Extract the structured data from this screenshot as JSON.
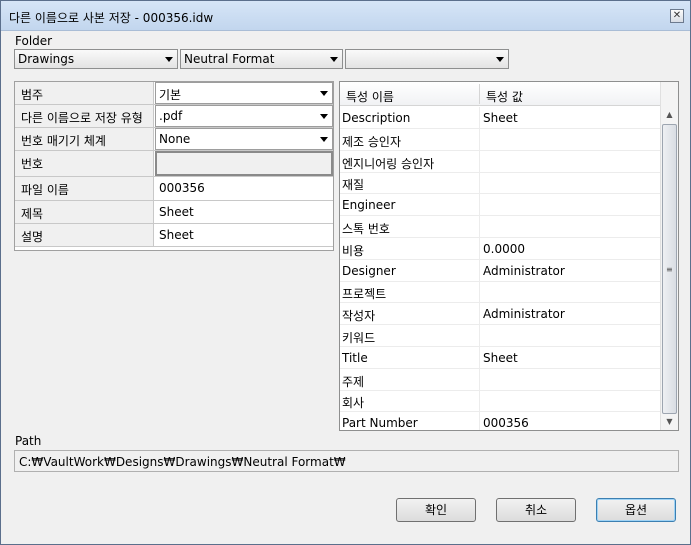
{
  "window": {
    "title": "다른 이름으로 사본 저장 - 000356.idw",
    "close_glyph": "✕"
  },
  "folder": {
    "label": "Folder",
    "combo1": "Drawings",
    "combo2": "Neutral Format",
    "combo3": ""
  },
  "left_grid": [
    {
      "name": "범주",
      "value": "기본",
      "kind": "combo"
    },
    {
      "name": "다른 이름으로 저장 유형",
      "value": ".pdf",
      "kind": "combo"
    },
    {
      "name": "번호 매기기 체계",
      "value": "None",
      "kind": "combo"
    },
    {
      "name": "번호",
      "value": "",
      "kind": "disabled"
    },
    {
      "name": "파일 이름",
      "value": "000356",
      "kind": "text"
    },
    {
      "name": "제목",
      "value": "Sheet",
      "kind": "text"
    },
    {
      "name": "설명",
      "value": "Sheet",
      "kind": "text"
    }
  ],
  "props": {
    "col1": "특성 이름",
    "col2": "특성 값",
    "rows": [
      {
        "name": "Description",
        "value": "Sheet"
      },
      {
        "name": "제조 승인자",
        "value": ""
      },
      {
        "name": "엔지니어링 승인자",
        "value": ""
      },
      {
        "name": "재질",
        "value": ""
      },
      {
        "name": "Engineer",
        "value": ""
      },
      {
        "name": "스톡 번호",
        "value": ""
      },
      {
        "name": "비용",
        "value": "0.0000"
      },
      {
        "name": "Designer",
        "value": "Administrator"
      },
      {
        "name": "프로젝트",
        "value": ""
      },
      {
        "name": "작성자",
        "value": "Administrator"
      },
      {
        "name": "키워드",
        "value": ""
      },
      {
        "name": "Title",
        "value": "Sheet"
      },
      {
        "name": "주제",
        "value": ""
      },
      {
        "name": "회사",
        "value": ""
      },
      {
        "name": "Part Number",
        "value": "000356"
      }
    ]
  },
  "path": {
    "label": "Path",
    "value": "C:₩VaultWork₩Designs₩Drawings₩Neutral Format₩"
  },
  "buttons": {
    "ok": "확인",
    "cancel": "취소",
    "options": "옵션"
  }
}
